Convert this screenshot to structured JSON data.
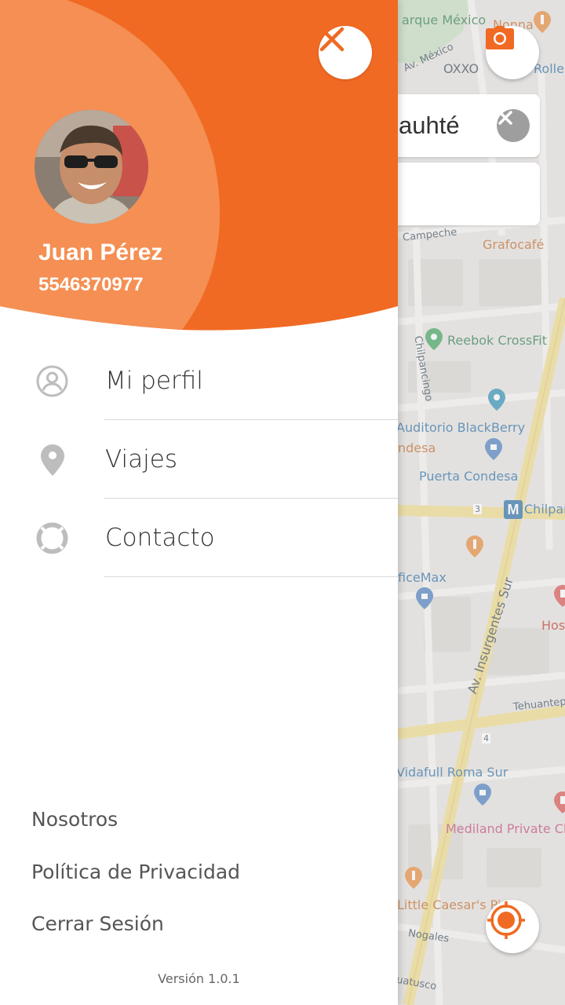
{
  "user": {
    "name": "Juan Pérez",
    "phone": "5546370977"
  },
  "menu": {
    "items": [
      {
        "label": "Mi perfil",
        "icon": "profile-icon"
      },
      {
        "label": "Viajes",
        "icon": "location-pin-icon"
      },
      {
        "label": "Contacto",
        "icon": "lifebuoy-icon"
      }
    ]
  },
  "footer": {
    "links": [
      "Nosotros",
      "Política de Privacidad",
      "Cerrar Sesión"
    ],
    "version": "Versión 1.0.1"
  },
  "search": {
    "origin_text": "auhté",
    "destination_text": ""
  },
  "map": {
    "labels": {
      "mexico": "arque México",
      "oxxo": "OXXO",
      "av_mexico": "Av. México",
      "nonna": "Nonna",
      "rolle": "Rolle",
      "campeche": "Campeche",
      "grafocafe": "Grafocafé",
      "reebok": "Reebok CrossFit",
      "chilpancingo": "Chilpancingo",
      "blackberry": "Auditorio BlackBerry",
      "condesa": "ndesa",
      "puerta_condesa": "Puerta Condesa",
      "chilpa": "Chilpan",
      "metro_num": "3",
      "officemax": "ficeMax",
      "insurgentes": "Av. Insurgentes Sur",
      "hos": "Hos",
      "tehuantepec": "Tehuantep",
      "num4": "4",
      "vidafull": "Vidafull Roma Sur",
      "mediland": "Mediland Private Cli",
      "littlecaesars": "Little Caesar's Piz",
      "nogales": "Nogales",
      "huatusco": "uatusco"
    }
  },
  "colors": {
    "brand_orange": "#F06A23",
    "brand_orange_light": "#F58F53",
    "text_dark": "#333333",
    "divider": "#D9D9D9"
  }
}
